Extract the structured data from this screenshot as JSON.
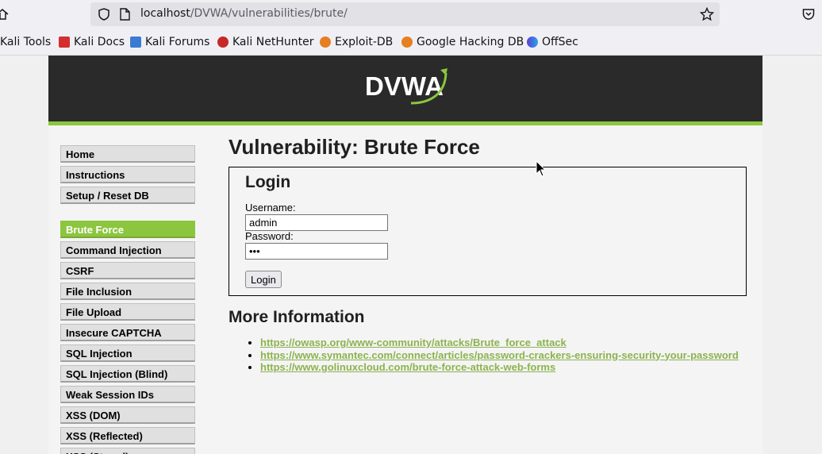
{
  "browser": {
    "url_host": "localhost",
    "url_path": "/DVWA/vulnerabilities/brute/",
    "bookmarks": [
      {
        "label": "Kali Tools",
        "icon": "kali-icon"
      },
      {
        "label": "Kali Docs",
        "icon": "kali-docs-icon"
      },
      {
        "label": "Kali Forums",
        "icon": "kali-forums-icon"
      },
      {
        "label": "Kali NetHunter",
        "icon": "nethunter-icon"
      },
      {
        "label": "Exploit-DB",
        "icon": "exploit-db-icon"
      },
      {
        "label": "Google Hacking DB",
        "icon": "ghdb-icon"
      },
      {
        "label": "OffSec",
        "icon": "offsec-icon"
      }
    ]
  },
  "dvwa": {
    "logo_text": "DVWA",
    "menu": [
      {
        "label": "Home"
      },
      {
        "label": "Instructions"
      },
      {
        "label": "Setup / Reset DB"
      },
      {
        "label": "Brute Force",
        "active": true
      },
      {
        "label": "Command Injection"
      },
      {
        "label": "CSRF"
      },
      {
        "label": "File Inclusion"
      },
      {
        "label": "File Upload"
      },
      {
        "label": "Insecure CAPTCHA"
      },
      {
        "label": "SQL Injection"
      },
      {
        "label": "SQL Injection (Blind)"
      },
      {
        "label": "Weak Session IDs"
      },
      {
        "label": "XSS (DOM)"
      },
      {
        "label": "XSS (Reflected)"
      },
      {
        "label": "XSS (Stored)"
      }
    ],
    "page_title": "Vulnerability: Brute Force",
    "login": {
      "heading": "Login",
      "username_label": "Username:",
      "username_value": "admin",
      "password_label": "Password:",
      "password_value": "•••",
      "button": "Login"
    },
    "more_info_heading": "More Information",
    "links": [
      "https://owasp.org/www-community/attacks/Brute_force_attack",
      "https://www.symantec.com/connect/articles/password-crackers-ensuring-security-your-password",
      "https://www.golinuxcloud.com/brute-force-attack-web-forms"
    ]
  },
  "colors": {
    "accent_green": "#8cc63f",
    "header_dark": "#2a2a2a",
    "link_green": "#8cb34f"
  }
}
